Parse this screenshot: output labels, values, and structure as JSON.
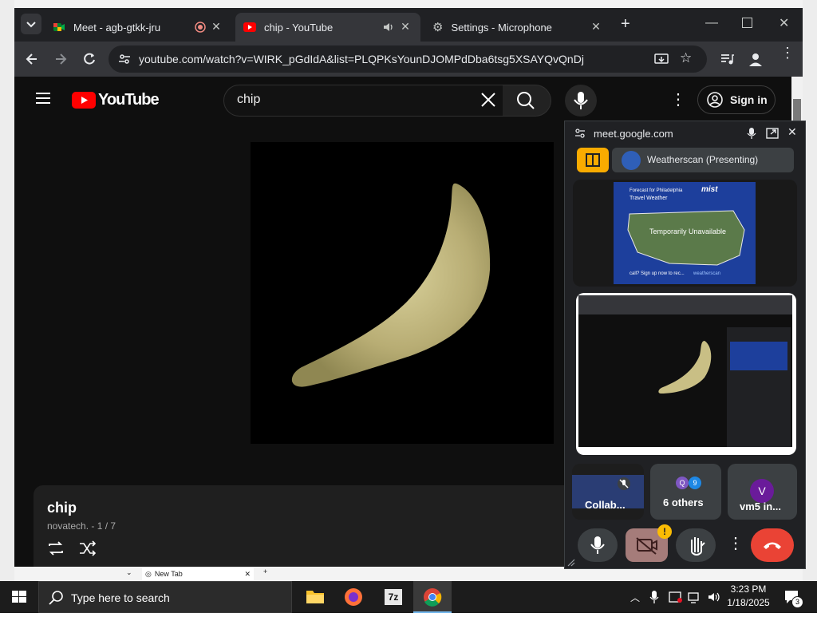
{
  "browser": {
    "tabs": [
      {
        "title": "Meet - agb-gtkk-jru",
        "icon": "google-meet-icon"
      },
      {
        "title": "chip - YouTube",
        "icon": "youtube-icon"
      },
      {
        "title": "Settings - Microphone",
        "icon": "gear-icon"
      }
    ],
    "url": "youtube.com/watch?v=WIRK_pGdIdA&list=PLQPKsYounDJOMPdDba6tsg5XSAYQvQnDj"
  },
  "youtube": {
    "logo_text": "YouTube",
    "search_value": "chip",
    "signin_label": "Sign in",
    "video_title": "chip",
    "playlist_info": "novatech. - 1 / 7"
  },
  "meet": {
    "domain": "meet.google.com",
    "presenting_label": "Weatherscan (Presenting)",
    "weather_line1": "Forecast for Philadelphia",
    "weather_line2": "Travel Weather",
    "weather_status": "Temporarily Unavailable",
    "weather_bottom": "call? Sign up now to rec...",
    "weather_brand": "weatherscan",
    "weather_logo": "mist",
    "tile_collab": "Collab...",
    "tile_others": "6 others",
    "tile_vm5": "vm5 in...",
    "avatar_v": "V",
    "avatar_small_1": "Q",
    "avatar_small_2": "9",
    "warning_badge": "!"
  },
  "mini_tab": {
    "title": "New Tab"
  },
  "taskbar": {
    "search_placeholder": "Type here to search",
    "time": "3:23 PM",
    "date": "1/18/2025",
    "notification_count": "3"
  },
  "colors": {
    "youtube_red": "#ff0000",
    "end_call_red": "#ea4335",
    "warning_yellow": "#fbbc04"
  }
}
